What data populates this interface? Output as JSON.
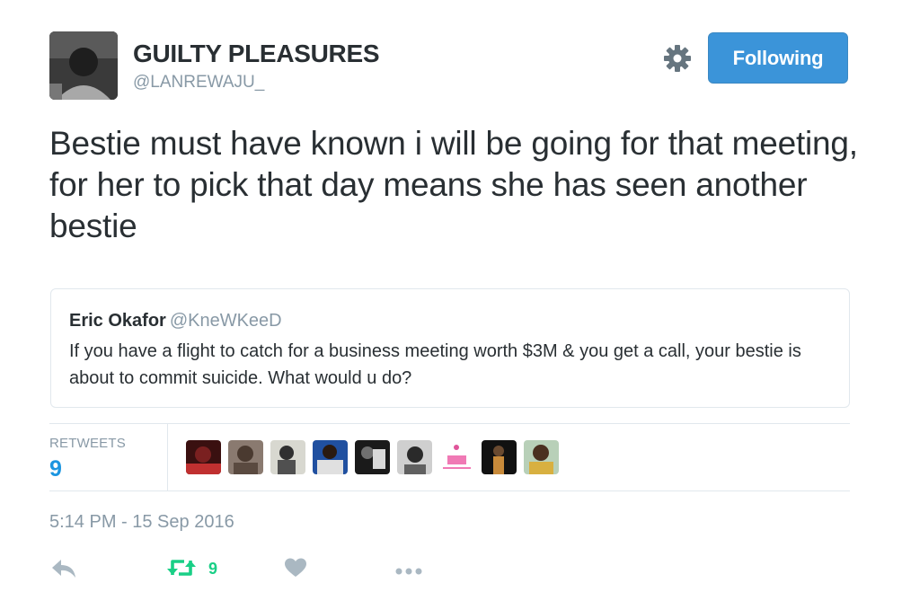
{
  "tweet": {
    "author_name": "GUILTY PLEASURES",
    "author_handle": "@LANREWAJU_",
    "follow_button_label": "Following",
    "text": "Bestie must have known i will be going for that meeting, for her to pick that day means she has seen another bestie",
    "timestamp": "5:14 PM - 15 Sep 2016"
  },
  "quoted_tweet": {
    "author_name": "Eric Okafor",
    "author_handle": "@KneWKeeD",
    "text": "If you have a flight to catch for a business meeting worth $3M &  you get a call, your bestie is about to commit suicide.  What would u do?"
  },
  "stats": {
    "retweets_label": "RETWEETS",
    "retweets_count": "9"
  },
  "actions": {
    "retweet_count": "9"
  },
  "icons": {
    "settings": "gear-icon",
    "reply": "reply-icon",
    "retweet": "retweet-icon",
    "like": "heart-icon",
    "more": "more-dots-icon"
  },
  "colors": {
    "follow_button": "#3b94d9",
    "link_blue": "#1b95e0",
    "retweet_green": "#19cf86",
    "muted_gray": "#8899a6",
    "icon_gray": "#aab8c2",
    "text": "#292f33"
  }
}
